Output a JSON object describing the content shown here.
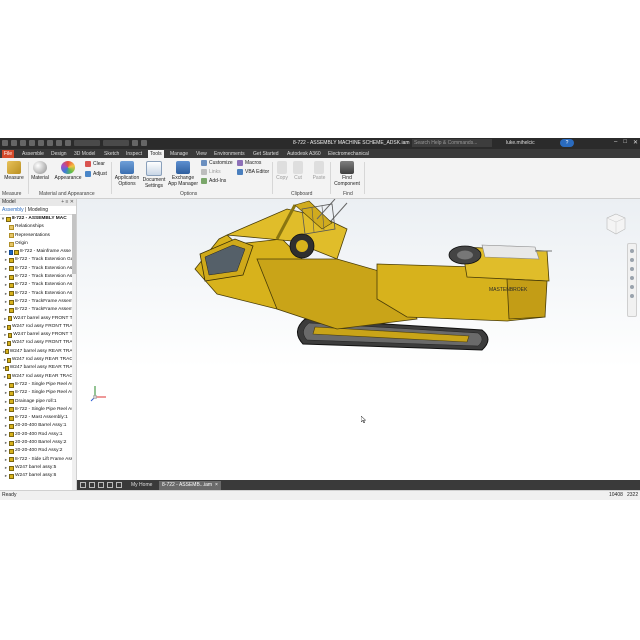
{
  "titlebar": {
    "title": "8-722 - ASSEMBLY MACHINE SCHEME_ADSK.iam",
    "search_placeholder": "Search Help & Commands...",
    "user": "luke.mihelcic",
    "help_icon": "question-icon"
  },
  "ribbon_tabs": [
    "File",
    "Assemble",
    "Design",
    "3D Model",
    "Sketch",
    "Inspect",
    "Tools",
    "Manage",
    "View",
    "Environments",
    "Get Started",
    "Autodesk A360",
    "Electromechanical"
  ],
  "active_tab": "Tools",
  "ribbon": {
    "measure_label": "Measure",
    "material_label": "Material",
    "appearance_label": "Appearance",
    "clear_label": "Clear",
    "adjust_label": "Adjust",
    "app_options_label": "Application Options",
    "doc_settings_label": "Document Settings",
    "exchange_label": "Exchange App Manager",
    "customize_label": "Customize",
    "links_label": "Links",
    "addins_label": "Add-Ins",
    "macros_label": "Macros",
    "vba_label": "VBA Editor",
    "copy_label": "Copy",
    "cut_label": "Cut",
    "paste_label": "Paste",
    "find_label": "Find Component",
    "panels": {
      "measure": "Measure",
      "material": "Material and Appearance",
      "options": "Options",
      "clipboard": "Clipboard",
      "find": "Find"
    }
  },
  "browser": {
    "header": "Model",
    "tabs": [
      "Assembly",
      "Modeling"
    ],
    "items": [
      "8-722 - ASSEMBLY MAC",
      "Relationships",
      "Representations",
      "Origin",
      "8-722 - Mainframe Asse",
      "8-722 - Track Extension Gus",
      "8-722 - Track Extension Ass",
      "8-722 - Track Extension Ass",
      "8-722 - Track Extension Ass",
      "8-722 - Track Extension Ass",
      "8-722 - TrackFrame Assemb",
      "8-722 - TrackFrame Assemb",
      "W247 barrel assy FRONT TR",
      "W247 rod assy FRONT TRAC",
      "W247 barrel assy FRONT TR",
      "W247 rod assy FRONT TRAC",
      "W247 barrel assy REAR TRAC",
      "W247 rod assy REAR TRACK",
      "W247 barrel assy REAR TRAC",
      "W247 rod assy REAR TRACK",
      "8-722 - Single Pipe Reel Ass",
      "8-722 - Single Pipe Reel Ass",
      "Drainage pipe roll:1",
      "8-722 - Single Pipe Reel Ass",
      "8-722 - Mast Assembly:1",
      "20-20-400 Barrel Assy:1",
      "20-20-400 Rod Assy:1",
      "20-20-400 Barrel Assy:2",
      "20-20-400 Rod Assy:2",
      "8-722 - Side Lift Frame Ass",
      "W247 barrel assy:5",
      "W247 barrel assy:6"
    ]
  },
  "machine": {
    "brand_text": "MASTENBROEK"
  },
  "doc_tabs": {
    "home": "My Home",
    "doc": "8-722 - ASSEMB...iam"
  },
  "status": {
    "ready": "Ready",
    "count1": "10408",
    "count2": "2322"
  },
  "colors": {
    "machine_yellow": "#d7b21c",
    "file_tab": "#d34a2b",
    "dark_chrome": "#2b2b2b"
  }
}
